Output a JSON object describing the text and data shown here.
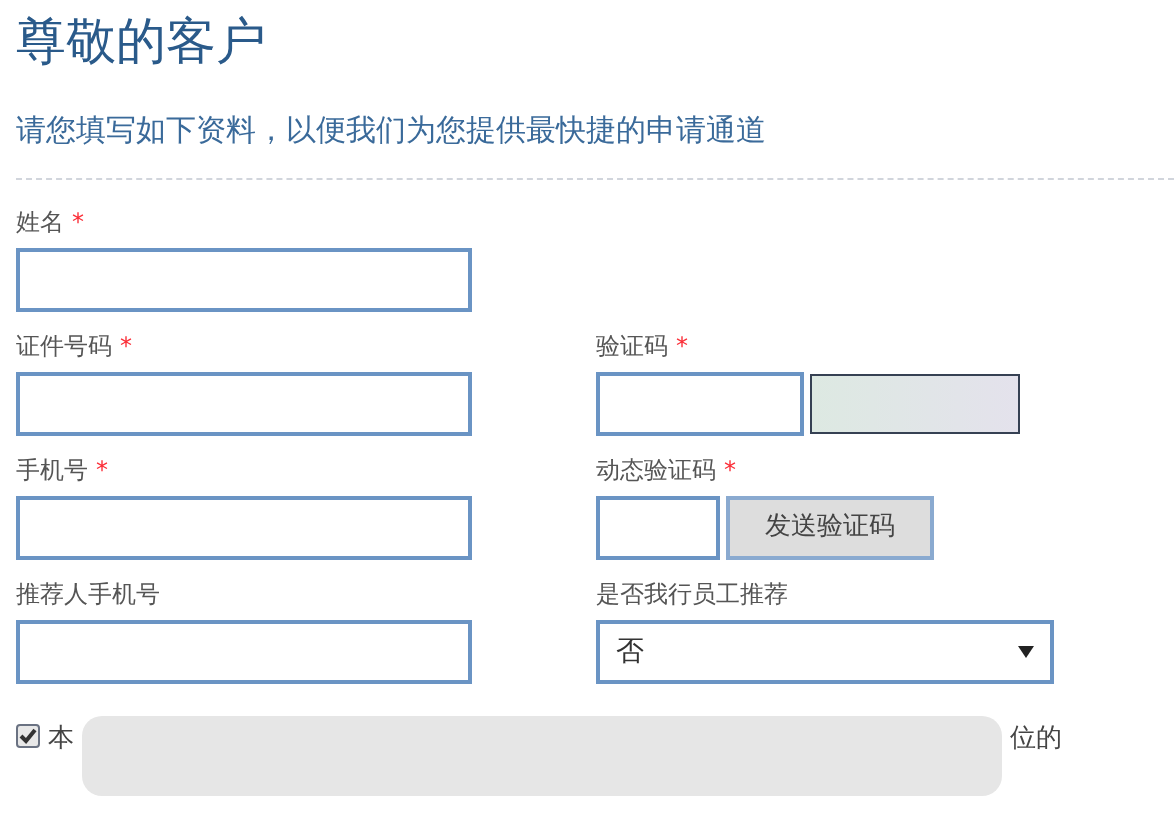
{
  "title": "尊敬的客户",
  "subtitle": "请您填写如下资料，以便我们为您提供最快捷的申请通道",
  "fields": [
    {
      "kind": "text",
      "label": "姓名",
      "mark": "*"
    },
    {
      "kind": "spacer"
    },
    {
      "kind": "text",
      "label": "证件号码",
      "mark": "*"
    },
    {
      "kind": "captcha",
      "label": "验证码",
      "mark": "*"
    },
    {
      "kind": "text",
      "label": "手机号",
      "mark": "*"
    },
    {
      "kind": "sms",
      "label": "动态验证码",
      "mark": "*",
      "button": "发送验证码"
    },
    {
      "kind": "text",
      "label": "推荐人手机号"
    },
    {
      "kind": "select",
      "label": "是否我行员工推荐",
      "value": "否"
    }
  ],
  "agreement": {
    "checked": true,
    "text_start": "本",
    "text_end": "位的"
  }
}
